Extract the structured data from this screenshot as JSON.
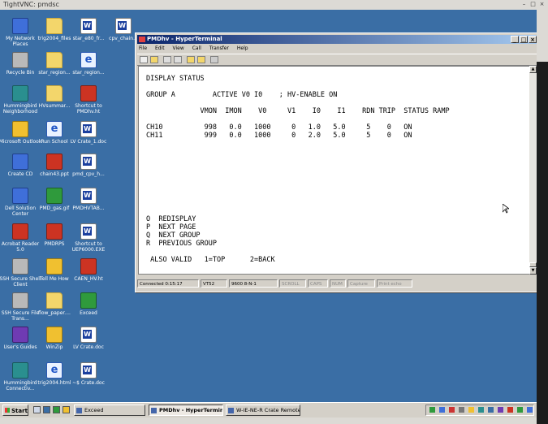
{
  "vnc": {
    "title": "TightVNC: pmdsc"
  },
  "desktop_icons": [
    {
      "label": "My Network Places",
      "kind": "blue"
    },
    {
      "label": "trig2004_files",
      "kind": "folder"
    },
    {
      "label": "star_e80_fr...",
      "kind": "doc"
    },
    {
      "label": "cpv_chain...",
      "kind": "doc"
    },
    {
      "label": "Recycle Bin",
      "kind": "gray"
    },
    {
      "label": "star_region...",
      "kind": "folder"
    },
    {
      "label": "star_region...",
      "kind": "ie"
    },
    {
      "label": "Hummingbird Neighborhood",
      "kind": "teal"
    },
    {
      "label": "HVsummar...",
      "kind": "folder"
    },
    {
      "label": "Shortcut to PMDhv.ht",
      "kind": "red"
    },
    {
      "label": "Microsoft Outlook",
      "kind": "yellow"
    },
    {
      "label": "Run School",
      "kind": "ie"
    },
    {
      "label": "LV Crate_1.doc",
      "kind": "doc"
    },
    {
      "label": "Create CD",
      "kind": "blue"
    },
    {
      "label": "chain43.ppt",
      "kind": "red"
    },
    {
      "label": "pmd_cpv_h...",
      "kind": "doc"
    },
    {
      "label": "Dell Solution Center",
      "kind": "blue"
    },
    {
      "label": "PMD_gas.gif",
      "kind": "green"
    },
    {
      "label": "PMDHVTAB...",
      "kind": "doc"
    },
    {
      "label": "Acrobat Reader 5.0",
      "kind": "red"
    },
    {
      "label": "PMDRPS",
      "kind": "red"
    },
    {
      "label": "Shortcut to UEP6000.EXE",
      "kind": "doc"
    },
    {
      "label": "SSH Secure Shell Client",
      "kind": "gray"
    },
    {
      "label": "Tell Me How",
      "kind": "yellow"
    },
    {
      "label": "CAEN_HV.ht",
      "kind": "red"
    },
    {
      "label": "SSH Secure File Trans...",
      "kind": "gray"
    },
    {
      "label": "flow_paper....",
      "kind": "folder"
    },
    {
      "label": "Exceed",
      "kind": "green"
    },
    {
      "label": "User's Guides",
      "kind": "purple"
    },
    {
      "label": "WinZip",
      "kind": "yellow"
    },
    {
      "label": "LV Crate.doc",
      "kind": "doc"
    },
    {
      "label": "Hummingbird Connectiv...",
      "kind": "teal"
    },
    {
      "label": "trig2004.html",
      "kind": "ie"
    },
    {
      "label": "~$ Crate.doc",
      "kind": "doc"
    }
  ],
  "hyperterminal": {
    "title": "PMDhv - HyperTerminal",
    "menu": [
      "File",
      "Edit",
      "View",
      "Call",
      "Transfer",
      "Help"
    ],
    "terminal_lines": [
      "DISPLAY STATUS",
      "",
      "GROUP A         ACTIVE V0 I0    ; HV-ENABLE ON",
      "",
      "             VMON  IMON    V0     V1    I0    I1    RDN TRIP  STATUS RAMP",
      "",
      "CH10          998   0.0   1000     0   1.0   5.0     5    0   ON",
      "CH11          999   0.0   1000     0   2.0   5.0     5    0   ON"
    ],
    "terminal_menu_lines": [
      "O  REDISPLAY",
      "P  NEXT PAGE",
      "Q  NEXT GROUP",
      "R  PREVIOUS GROUP",
      "",
      " ALSO VALID   1=TOP      2=BACK"
    ],
    "status": {
      "connected": "Connected 0:15:17",
      "emulation": "VT52",
      "port": "9600 8-N-1",
      "scroll": "SCROLL",
      "caps": "CAPS",
      "num": "NUM",
      "capture": "Capture",
      "print_echo": "Print echo"
    }
  },
  "taskbar": {
    "start": "Start",
    "tasks": [
      {
        "label": "Exceed",
        "active": false
      },
      {
        "label": "PMDhv - HyperTerminal",
        "active": true
      },
      {
        "label": "W-IE-NE-R Crate Remote...",
        "active": false
      }
    ]
  }
}
